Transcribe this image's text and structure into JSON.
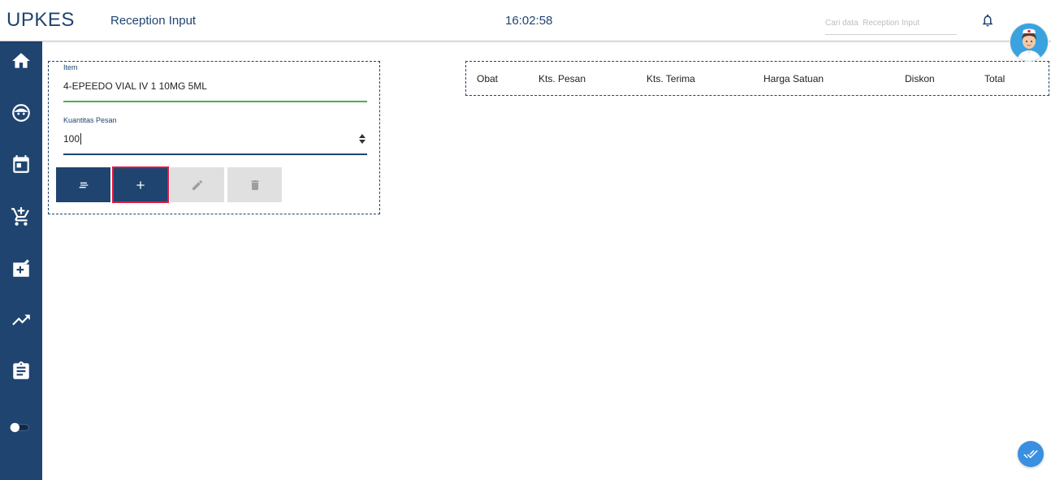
{
  "app": {
    "brand": "UPKES",
    "page_title": "Reception Input",
    "clock": "16:02:58"
  },
  "search": {
    "placeholder": "Cari data  Reception Input",
    "value": ""
  },
  "sidebar": {
    "items": [
      {
        "icon": "home-icon"
      },
      {
        "icon": "face-icon"
      },
      {
        "icon": "calendar-icon"
      },
      {
        "icon": "add-to-cart-icon"
      },
      {
        "icon": "medical-box-icon"
      },
      {
        "icon": "trending-up-icon"
      },
      {
        "icon": "clipboard-icon"
      },
      {
        "icon": "toggle-icon"
      }
    ]
  },
  "form": {
    "item_label": "Item",
    "item_value": "4-EPEEDO VIAL IV 1 10MG 5ML",
    "qty_label": "Kuantitas Pesan",
    "qty_value": "100",
    "buttons": [
      "list-icon",
      "add-icon",
      "edit-icon",
      "delete-icon"
    ]
  },
  "table": {
    "headers": [
      "Obat",
      "Kts. Pesan",
      "Kts. Terima",
      "Harga Satuan",
      "Diskon",
      "Total"
    ],
    "rows": []
  },
  "colors": {
    "primary": "#1f4470",
    "valid_underline": "#4caf50",
    "highlight": "#e3173e",
    "fab": "#3a8fe0",
    "disabled": "#e0e0e0"
  }
}
